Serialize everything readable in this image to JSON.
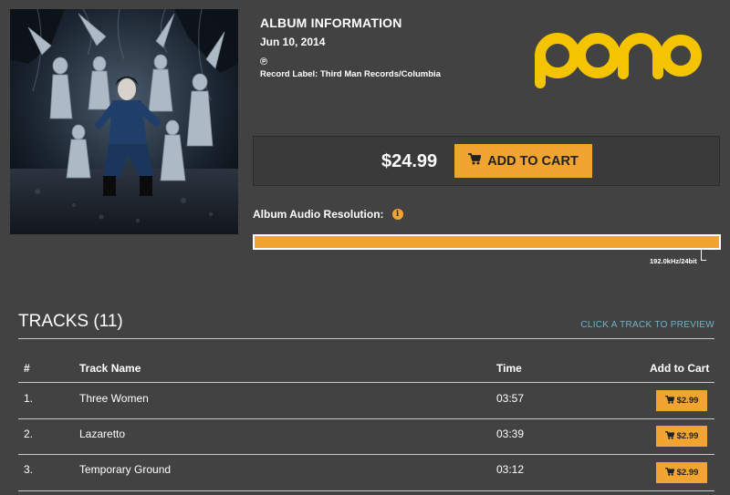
{
  "album": {
    "cover_alt": "Album cover artwork",
    "info_title": "ALBUM INFORMATION",
    "date": "Jun 10, 2014",
    "p_symbol": "℗",
    "record_label": "Record Label: Third Man Records/Columbia"
  },
  "brand": {
    "logo_text": "pono",
    "color": "#f5c400"
  },
  "purchase": {
    "price": "$24.99",
    "add_to_cart_label": "ADD TO CART",
    "accent": "#f1a530"
  },
  "resolution": {
    "label": "Album Audio Resolution:",
    "info_icon": "i",
    "value": "192.0kHz/24bit",
    "fill_fraction": 1.0
  },
  "tracks": {
    "title": "TRACKS (11)",
    "preview_hint": "CLICK A TRACK TO PREVIEW",
    "columns": {
      "number": "#",
      "name": "Track Name",
      "time": "Time",
      "cart": "Add to Cart"
    },
    "rows": [
      {
        "number": "1.",
        "name": "Three Women",
        "time": "03:57",
        "price": "$2.99"
      },
      {
        "number": "2.",
        "name": "Lazaretto",
        "time": "03:39",
        "price": "$2.99"
      },
      {
        "number": "3.",
        "name": "Temporary Ground",
        "time": "03:12",
        "price": "$2.99"
      }
    ]
  }
}
